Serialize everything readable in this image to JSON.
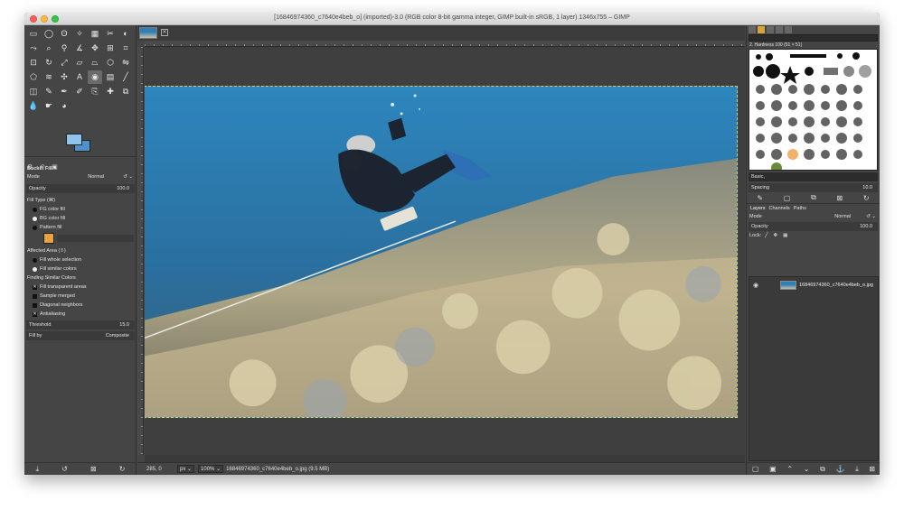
{
  "window": {
    "title": "[16846974360_c7640e4beb_o] (imported)-3.0 (RGB color 8-bit gamma integer, GIMP built-in sRGB, 1 layer) 1346x755 – GIMP"
  },
  "tool_options": {
    "title": "Bucket Fill",
    "mode_label": "Mode",
    "mode_value": "Normal",
    "opacity_label": "Opacity",
    "opacity_value": "100.0",
    "fill_type_label": "Fill Type  (⌘)",
    "fill_types": [
      "FG color fill",
      "BG color fill",
      "Pattern fill"
    ],
    "affected_area_label": "Affected Area  (⇧)",
    "affected_areas": [
      "Fill whole selection",
      "Fill similar colors"
    ],
    "finding_label": "Finding Similar Colors",
    "finding_options": [
      "Fill transparent areas",
      "Sample merged",
      "Diagonal neighbors",
      "Antialiasing"
    ],
    "threshold_label": "Threshold",
    "threshold_value": "15.0",
    "fill_by_label": "Fill by",
    "fill_by_value": "Composite"
  },
  "status": {
    "coords": "285, 0",
    "unit": "px",
    "zoom": "100%",
    "file_info": "16846974360_c7640e4beb_o.jpg (9.5 MB)"
  },
  "brushes": {
    "name": "2. Hardness 100 (51 × 51)",
    "preset": "Basic,",
    "spacing_label": "Spacing",
    "spacing_value": "10.0"
  },
  "layers": {
    "tabs": [
      "Layers",
      "Channels",
      "Paths"
    ],
    "mode_label": "Mode",
    "mode_value": "Normal",
    "opacity_label": "Opacity",
    "opacity_value": "100.0",
    "lock_label": "Lock:",
    "layer_name": "16846974360_c7640e4beb_o.jpg"
  },
  "colors": {
    "foreground": "#8fc4eb",
    "background": "#4d92cc",
    "pattern_swatch": "#e8a33b"
  }
}
